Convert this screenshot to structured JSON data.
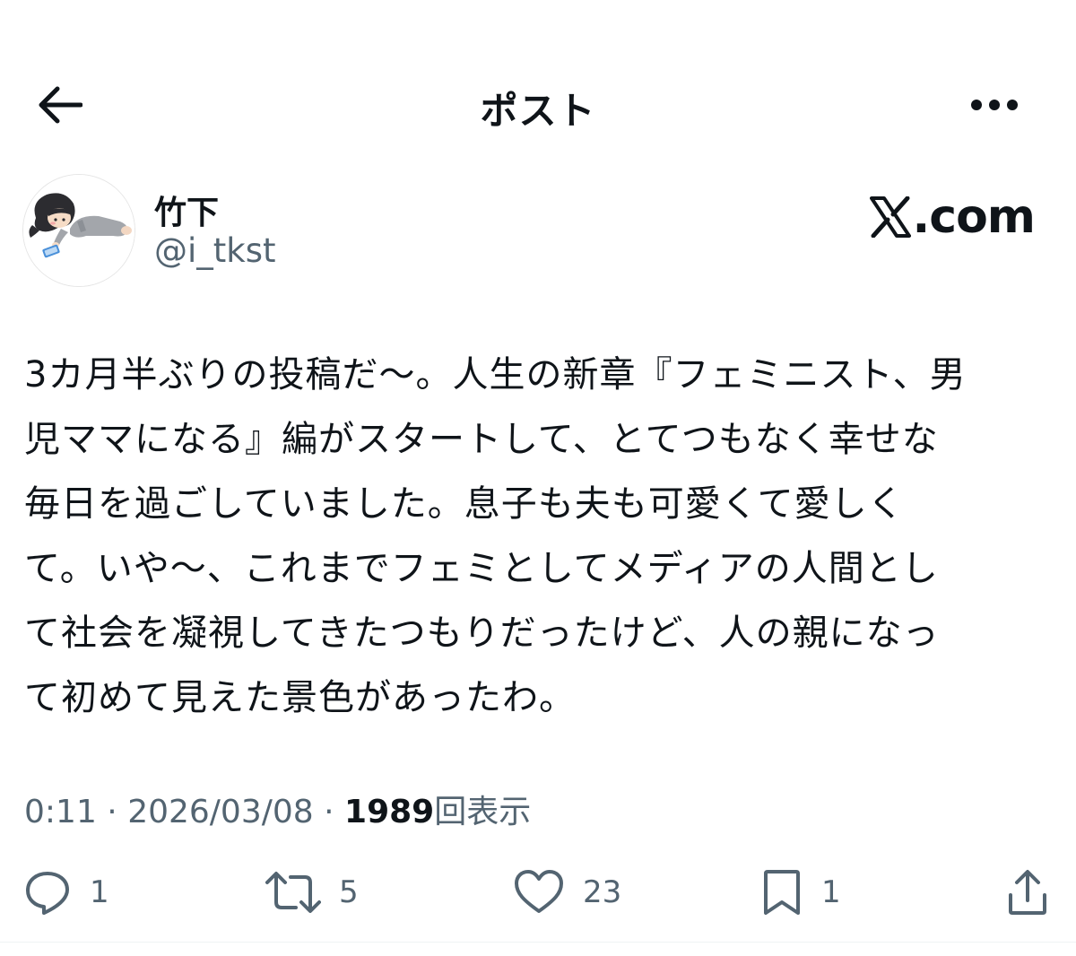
{
  "header": {
    "title": "ポスト",
    "back_icon": "arrow-left-icon",
    "more_icon": "more-horizontal-icon"
  },
  "author": {
    "display_name": "竹下",
    "handle": "@i_tkst"
  },
  "watermark": {
    "text": ".com"
  },
  "post": {
    "lines": [
      "3カ月半ぶりの投稿だ〜。人生の新章『フェミニスト、男",
      "児ママになる』編がスタートして、とてつもなく幸せな",
      "毎日を過ごしていました。息子も夫も可愛くて愛しく",
      "て。いや〜、これまでフェミとしてメディアの人間とし",
      "て社会を凝視してきたつもりだったけど、人の親になっ",
      "て初めて見えた景色があったわ。"
    ]
  },
  "meta": {
    "time": "0:11",
    "separator": " · ",
    "date": "2026/03/08",
    "views_count": "1989",
    "views_label": "回表示"
  },
  "actions": {
    "reply_count": "1",
    "repost_count": "5",
    "like_count": "23",
    "bookmark_count": "1"
  },
  "colors": {
    "text_primary": "#0f1419",
    "text_secondary": "#536471",
    "divider": "#eff3f4"
  }
}
